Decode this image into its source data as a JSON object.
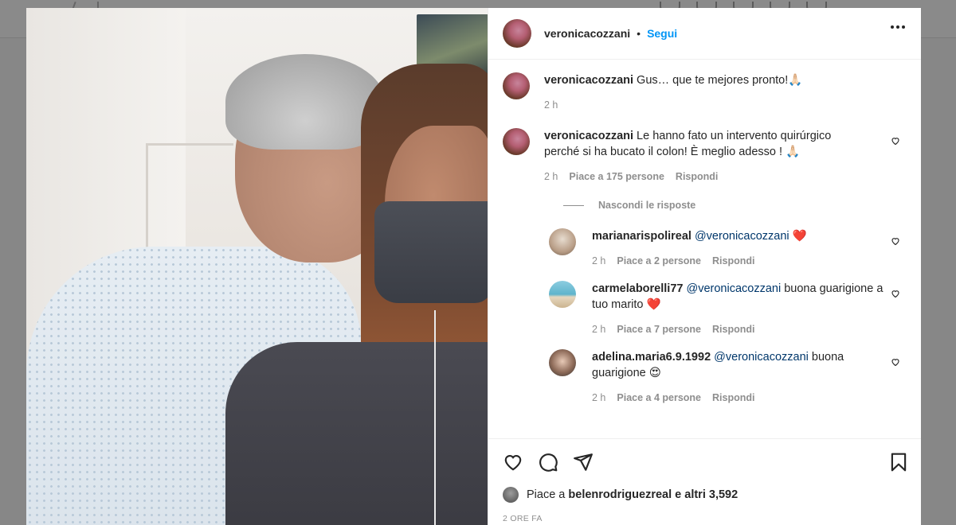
{
  "post": {
    "author": "veronicacozzani",
    "follow_label": "Segui",
    "dot": "•"
  },
  "comments": [
    {
      "user": "veronicacozzani",
      "text": "Gus… que te mejores pronto!🙏🏻",
      "time": "2 h"
    },
    {
      "user": "veronicacozzani",
      "text": "Le hanno fato un intervento quirúrgico perché si ha bucato il colon! È meglio adesso ! 🙏🏻",
      "time": "2 h",
      "likes": "Piace a 175 persone",
      "reply_label": "Rispondi"
    }
  ],
  "hide_replies_label": "Nascondi le risposte",
  "replies": [
    {
      "user": "marianarispolireal",
      "mention": "@veronicacozzani",
      "text": "❤️",
      "time": "2 h",
      "likes": "Piace a 2 persone",
      "reply_label": "Rispondi"
    },
    {
      "user": "carmelaborelli77",
      "mention": "@veronicacozzani",
      "text": "buona guarigione a tuo marito ❤️",
      "time": "2 h",
      "likes": "Piace a 7 persone",
      "reply_label": "Rispondi"
    },
    {
      "user": "adelina.maria6.9.1992",
      "mention": "@veronicacozzani",
      "text": "buona guarigione 😍",
      "time": "2 h",
      "likes": "Piace a 4 persone",
      "reply_label": "Rispondi"
    }
  ],
  "likes_summary": {
    "prefix": "Piace a",
    "user": "belenrodriguezreal",
    "suffix": "e altri 3,592"
  },
  "post_time": "2 ORE FA",
  "icons": {
    "like": "heart-icon",
    "comment": "comment-icon",
    "share": "share-icon",
    "save": "bookmark-icon",
    "more": "more-options-icon"
  }
}
